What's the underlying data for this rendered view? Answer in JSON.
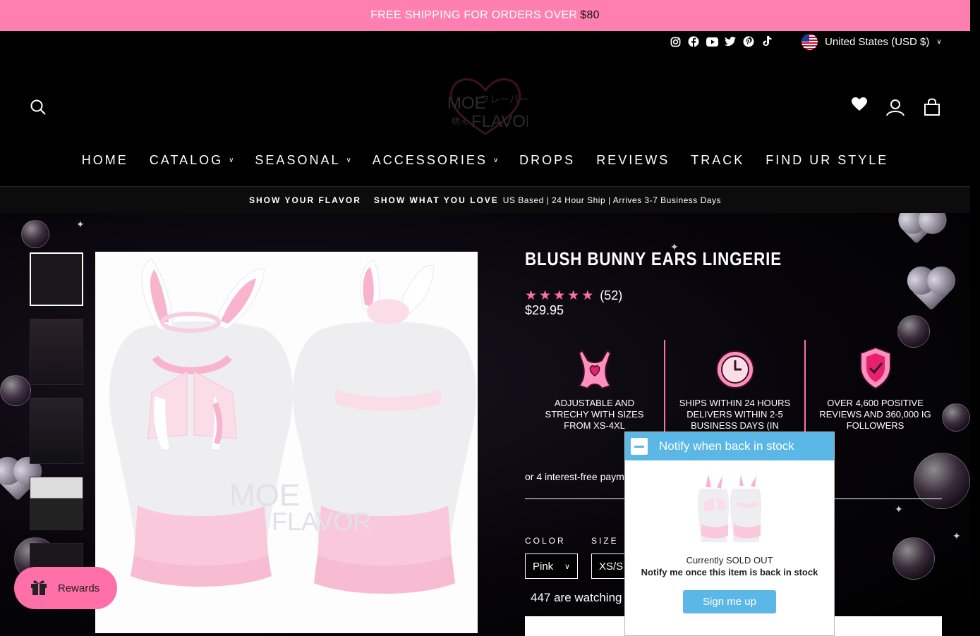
{
  "announcement": {
    "text": "FREE SHIPPING FOR ORDERS OVER",
    "amount": "$80"
  },
  "topbar": {
    "socials": [
      "instagram-icon",
      "facebook-icon",
      "youtube-icon",
      "twitter-icon",
      "pinterest-icon",
      "tiktok-icon"
    ],
    "country": "United States (USD $)"
  },
  "header": {
    "logo_alt": "MOE FLAVOR"
  },
  "nav": {
    "items": [
      {
        "label": "HOME",
        "dropdown": false
      },
      {
        "label": "CATALOG",
        "dropdown": true
      },
      {
        "label": "SEASONAL",
        "dropdown": true
      },
      {
        "label": "ACCESSORIES",
        "dropdown": true
      },
      {
        "label": "DROPS",
        "dropdown": false
      },
      {
        "label": "REVIEWS",
        "dropdown": false
      },
      {
        "label": "TRACK",
        "dropdown": false
      },
      {
        "label": "FIND UR STYLE",
        "dropdown": false
      }
    ]
  },
  "strip": {
    "a": "SHOW YOUR FLAVOR",
    "b": "SHOW WHAT YOU LOVE",
    "c": "US Based | 24 Hour Ship | Arrives 3-7 Business Days"
  },
  "product": {
    "title": "BLUSH BUNNY EARS LINGERIE",
    "rating_count": "(52)",
    "rating": 5,
    "price": "$29.95",
    "features": [
      {
        "icon": "bodysuit-icon",
        "text": "ADJUSTABLE AND STRECHY WITH SIZES FROM XS-4XL"
      },
      {
        "icon": "clock-icon",
        "text": "SHIPS WITHIN 24 HOURS DELIVERS WITHIN 2-5 BUSINESS DAYS (IN"
      },
      {
        "icon": "shield-check-icon",
        "text": "OVER 4,600 POSITIVE REVIEWS AND 360,000 IG FOLLOWERS"
      }
    ],
    "payment_text": "or 4 interest-free paym",
    "color_label": "COLOR",
    "color_value": "Pink",
    "size_label": "SIZE",
    "size_value": "XS/S",
    "watching": "447 are watching",
    "soldout_label": "SOLD OUT"
  },
  "rewards": {
    "label": "Rewards"
  },
  "popup": {
    "title": "Notify when back in stock",
    "status": "Currently SOLD OUT",
    "message": "Notify me once this item is back in stock",
    "button": "Sign me up"
  },
  "colors": {
    "accent": "#ff80b0",
    "popup": "#5ab7e6"
  }
}
